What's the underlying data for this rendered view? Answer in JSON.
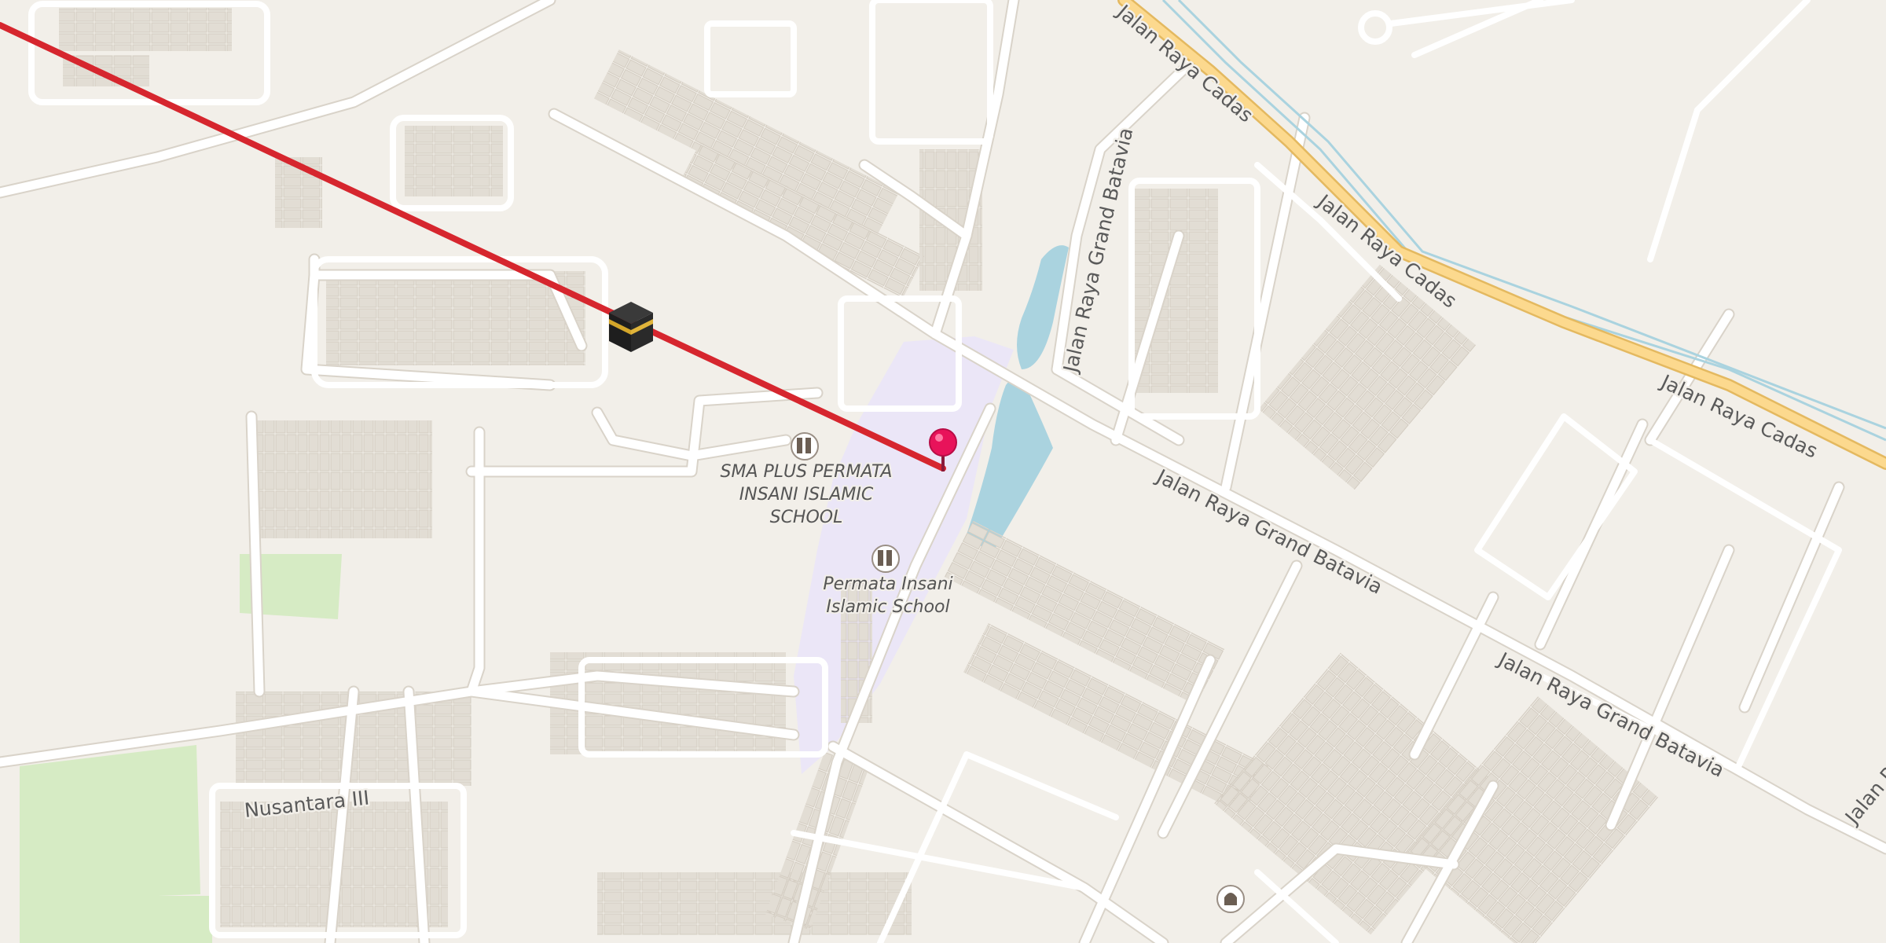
{
  "map": {
    "colors": {
      "land": "#f2efe9",
      "road": "#ffffff",
      "road_casing": "#d9d3c9",
      "building": "#e2ddd4",
      "building_outline": "#d3ccc1",
      "school_area": "#ebe6f7",
      "water": "#aad3df",
      "park": "#d6ebc4",
      "primary_road": "#fcd98e",
      "primary_casing": "#e4b960",
      "qibla_line": "#d6262e",
      "pin": "#e8135a"
    },
    "road_labels": [
      "Jalan Raya Cadas",
      "Jalan Raya Cadas",
      "Jalan Raya Cadas",
      "Jalan Raya Grand Batavia",
      "Jalan Raya Grand Batavia",
      "Jalan Raya Grand Batavia",
      "Jalan Raya Grand Batavia",
      "Nusantara III"
    ],
    "pois": [
      {
        "icon": "school-icon",
        "label_lines": [
          "SMA PLUS PERMATA",
          "INSANI ISLAMIC",
          "SCHOOL"
        ]
      },
      {
        "icon": "school-icon",
        "label_lines": [
          "Permata Insani",
          "Islamic School"
        ]
      },
      {
        "icon": "mosque-icon",
        "label_lines": []
      }
    ],
    "markers": {
      "kaaba": "kaaba-icon",
      "location_pin": "location-pin-icon"
    }
  }
}
